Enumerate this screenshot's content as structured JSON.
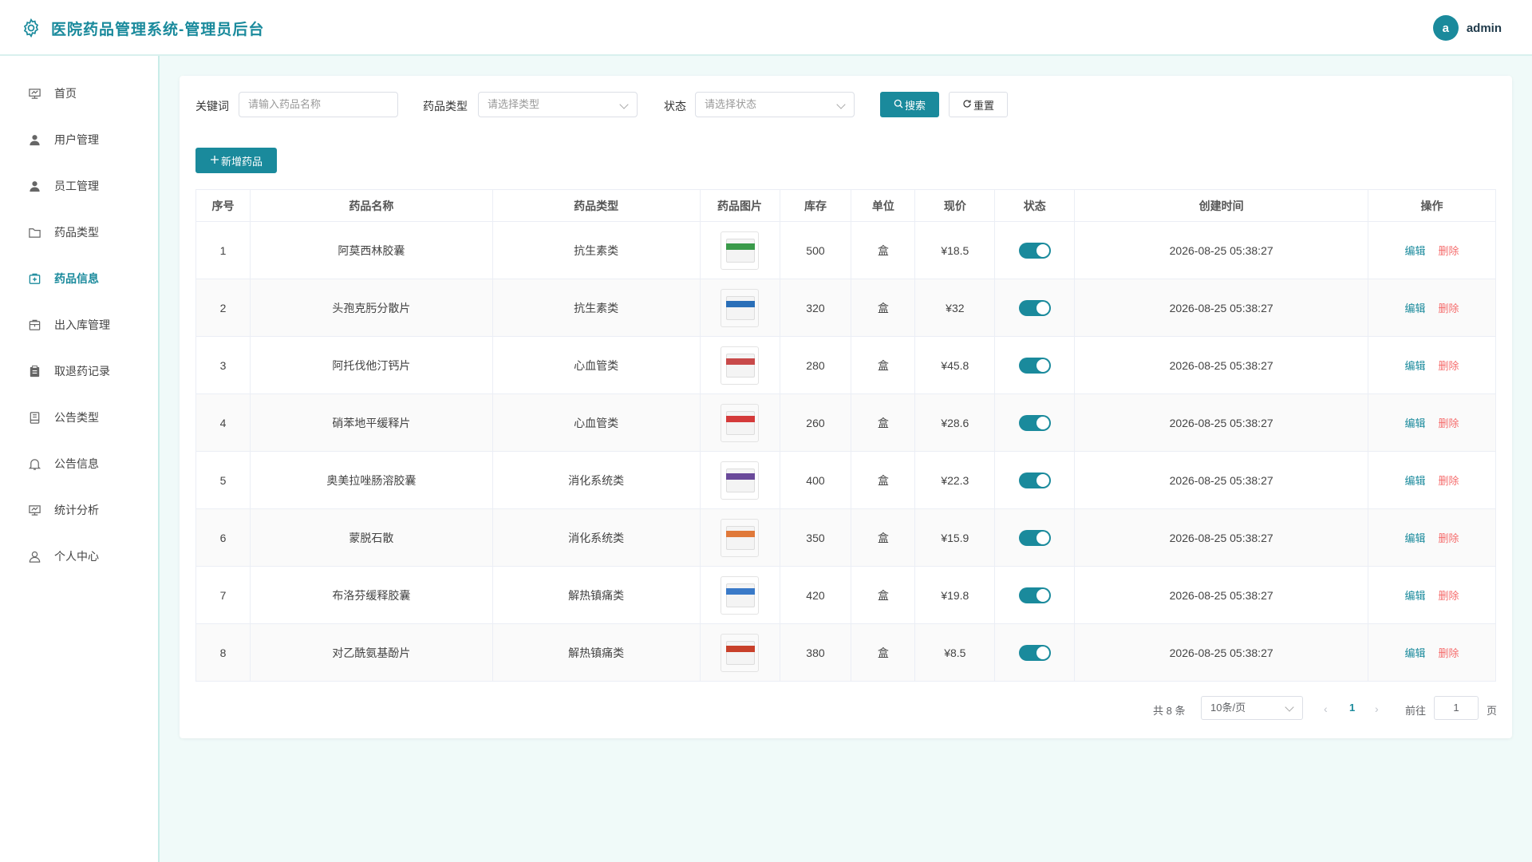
{
  "header": {
    "title": "医院药品管理系统-管理员后台",
    "avatar_letter": "a",
    "username": "admin",
    "accent": "#1a8a9c"
  },
  "sidebar": {
    "items": [
      {
        "label": "首页",
        "icon": "dashboard-icon"
      },
      {
        "label": "用户管理",
        "icon": "user-icon"
      },
      {
        "label": "员工管理",
        "icon": "staff-icon"
      },
      {
        "label": "药品类型",
        "icon": "folder-icon"
      },
      {
        "label": "药品信息",
        "icon": "medicine-box-icon",
        "active": true
      },
      {
        "label": "出入库管理",
        "icon": "package-icon"
      },
      {
        "label": "取退药记录",
        "icon": "clipboard-icon"
      },
      {
        "label": "公告类型",
        "icon": "notebook-icon"
      },
      {
        "label": "公告信息",
        "icon": "bell-icon"
      },
      {
        "label": "统计分析",
        "icon": "chart-icon"
      },
      {
        "label": "个人中心",
        "icon": "profile-icon"
      }
    ]
  },
  "filters": {
    "keyword_label": "关键词",
    "keyword_placeholder": "请输入药品名称",
    "type_label": "药品类型",
    "type_placeholder": "请选择类型",
    "status_label": "状态",
    "status_placeholder": "请选择状态",
    "search_label": "搜索",
    "reset_label": "重置"
  },
  "add_button_label": "新增药品",
  "table": {
    "headers": [
      "序号",
      "药品名称",
      "药品类型",
      "药品图片",
      "库存",
      "单位",
      "现价",
      "状态",
      "创建时间",
      "操作"
    ],
    "edit_label": "编辑",
    "delete_label": "删除",
    "rows": [
      {
        "no": "1",
        "name": "阿莫西林胶囊",
        "type": "抗生素类",
        "stock": "500",
        "unit": "盒",
        "price": "¥18.5",
        "enabled": true,
        "created": "2026-08-25 05:38:27",
        "img_color": "#3a9a4a"
      },
      {
        "no": "2",
        "name": "头孢克肟分散片",
        "type": "抗生素类",
        "stock": "320",
        "unit": "盒",
        "price": "¥32",
        "enabled": true,
        "created": "2026-08-25 05:38:27",
        "img_color": "#2a6fb8"
      },
      {
        "no": "3",
        "name": "阿托伐他汀钙片",
        "type": "心血管类",
        "stock": "280",
        "unit": "盒",
        "price": "¥45.8",
        "enabled": true,
        "created": "2026-08-25 05:38:27",
        "img_color": "#c84a4a"
      },
      {
        "no": "4",
        "name": "硝苯地平缓释片",
        "type": "心血管类",
        "stock": "260",
        "unit": "盒",
        "price": "¥28.6",
        "enabled": true,
        "created": "2026-08-25 05:38:27",
        "img_color": "#d43a3a"
      },
      {
        "no": "5",
        "name": "奥美拉唑肠溶胶囊",
        "type": "消化系统类",
        "stock": "400",
        "unit": "盒",
        "price": "¥22.3",
        "enabled": true,
        "created": "2026-08-25 05:38:27",
        "img_color": "#6a4a9a"
      },
      {
        "no": "6",
        "name": "蒙脱石散",
        "type": "消化系统类",
        "stock": "350",
        "unit": "盒",
        "price": "¥15.9",
        "enabled": true,
        "created": "2026-08-25 05:38:27",
        "img_color": "#e0793a"
      },
      {
        "no": "7",
        "name": "布洛芬缓释胶囊",
        "type": "解热镇痛类",
        "stock": "420",
        "unit": "盒",
        "price": "¥19.8",
        "enabled": true,
        "created": "2026-08-25 05:38:27",
        "img_color": "#3a7ac8"
      },
      {
        "no": "8",
        "name": "对乙酰氨基酚片",
        "type": "解热镇痛类",
        "stock": "380",
        "unit": "盒",
        "price": "¥8.5",
        "enabled": true,
        "created": "2026-08-25 05:38:27",
        "img_color": "#c8402a"
      }
    ]
  },
  "pagination": {
    "total_text": "共 8 条",
    "page_size": "10条/页",
    "current_page": "1",
    "goto_label": "前往",
    "goto_value": "1",
    "page_suffix": "页"
  }
}
